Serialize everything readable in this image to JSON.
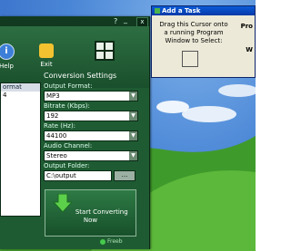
{
  "desktop": {
    "accent": "#2f66c4"
  },
  "converter": {
    "titlebar": {
      "help": "?",
      "minimize": "_",
      "close": "x"
    },
    "toolbar": {
      "help_label": "Help",
      "exit_label": "Exit"
    },
    "file_list": {
      "header": "ormat",
      "rows": [
        "4"
      ]
    },
    "settings": {
      "title": "Conversion Settings",
      "output_format": {
        "label": "Output Format:",
        "value": "MP3"
      },
      "bitrate": {
        "label": "Bitrate (Kbps):",
        "value": "192"
      },
      "rate": {
        "label": "Rate (Hz):",
        "value": "44100"
      },
      "audio_channel": {
        "label": "Audio Channel:",
        "value": "Stereo"
      },
      "output_folder": {
        "label": "Output Folder:",
        "value": "C:\\output",
        "browse": "..."
      }
    },
    "start_button": "Start Converting Now",
    "status": "Freeb"
  },
  "task_window": {
    "title": "Add a Task",
    "instruction": "Drag this Cursor onto a running Program Window to Select:",
    "right_text_1": "Pro",
    "right_text_2": "W"
  }
}
